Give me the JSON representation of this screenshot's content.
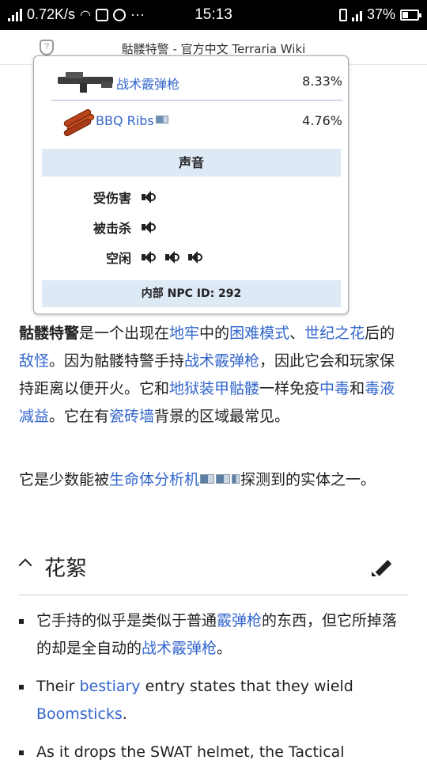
{
  "status": {
    "speed": "0.72K/s",
    "time": "15:13",
    "battery": "37%",
    "battery_level": 0.37,
    "dots": "···"
  },
  "titlebar": {
    "title": "骷髅特警 - 官方中文 Terraria Wiki",
    "shield_icon": "shield-question-icon"
  },
  "infobox": {
    "drops": [
      {
        "name": "战术霰弹枪",
        "percent": "8.33%",
        "icon": "tactical-shotgun-sprite"
      },
      {
        "name": "BBQ Ribs",
        "percent": "4.76%",
        "icon": "bbq-ribs-sprite"
      }
    ],
    "sound_heading": "声音",
    "sounds": [
      {
        "label": "受伤害",
        "count": 1
      },
      {
        "label": "被击杀",
        "count": 1
      },
      {
        "label": "空闲",
        "count": 3
      }
    ],
    "npc_id": "内部 NPC ID: 292"
  },
  "paragraph1": {
    "t1": "骷髅特警",
    "t2": "是一个出现在",
    "l1": "地牢",
    "t3": "中的",
    "l2": "困难模式",
    "t4": "、",
    "l3": "世纪之花",
    "t5": "后的",
    "l4": "敌怪",
    "t6": "。因为骷髅特警手持",
    "l5": "战术霰弹枪",
    "t7": "，因此它会和玩家保持距离以便开火。它和",
    "l6": "地狱装甲骷髅",
    "t8": "一样免疫",
    "l7": "中毒",
    "t9": "和",
    "l8": "毒液减益",
    "t10": "。它在有",
    "l9": "瓷砖墙",
    "t11": "背景的区域最常见。"
  },
  "paragraph2": {
    "t1": "它是少数能被",
    "l1": "生命体分析机",
    "t2": "探测到的实体之一。"
  },
  "section": {
    "title": "花絮"
  },
  "bullets": [
    {
      "t1": "它手持的似乎是类似于普通",
      "l1": "霰弹枪",
      "t2": "的东西，但它所掉落的却是全自动的",
      "l2": "战术霰弹枪",
      "t3": "。"
    },
    {
      "t1": "Their ",
      "l1": "bestiary",
      "t2": " entry states that they wield ",
      "l2": "Boomsticks",
      "t3": "."
    },
    {
      "t1": "As it drops the SWAT helmet, the Tactical Skeleton"
    }
  ]
}
